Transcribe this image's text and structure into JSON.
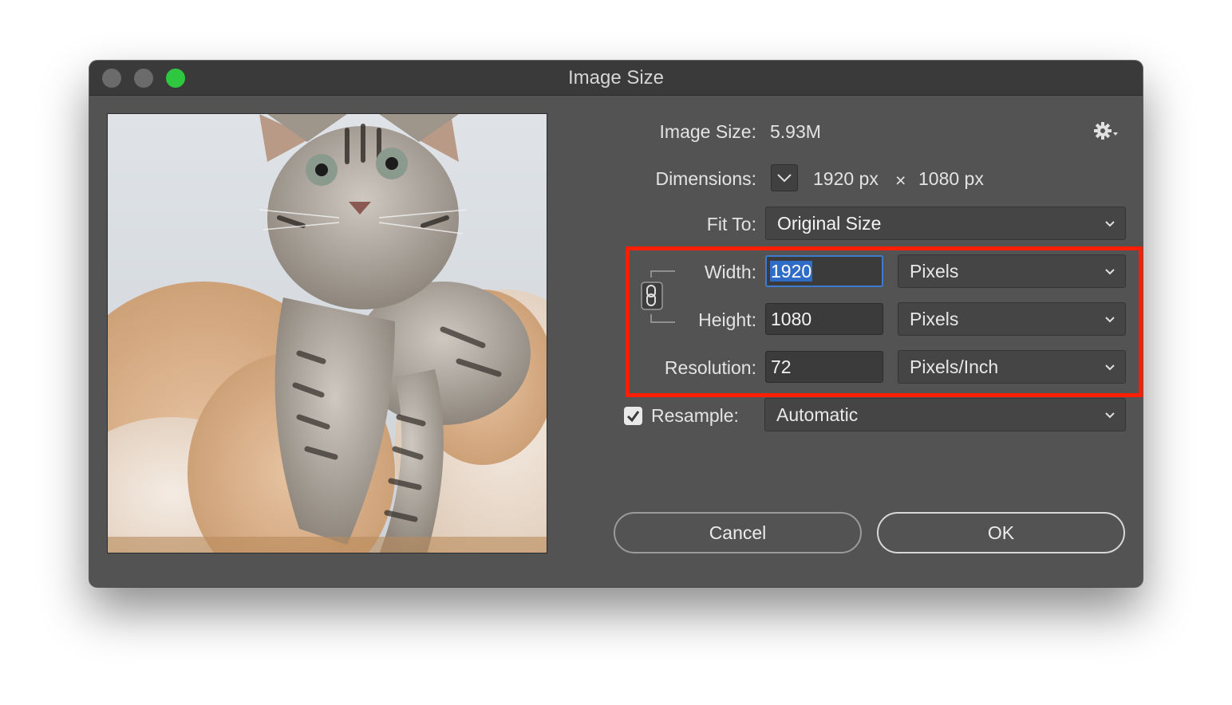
{
  "window": {
    "title": "Image Size"
  },
  "info": {
    "image_size_label": "Image Size:",
    "image_size_value": "5.93M",
    "dimensions_label": "Dimensions:",
    "dim_width": "1920 px",
    "dim_sep": "×",
    "dim_height": "1080 px"
  },
  "fit_to": {
    "label": "Fit To:",
    "value": "Original Size"
  },
  "width": {
    "label": "Width:",
    "value": "1920",
    "unit": "Pixels"
  },
  "height": {
    "label": "Height:",
    "value": "1080",
    "unit": "Pixels"
  },
  "resolution": {
    "label": "Resolution:",
    "value": "72",
    "unit": "Pixels/Inch"
  },
  "resample": {
    "label": "Resample:",
    "checked": true,
    "value": "Automatic"
  },
  "buttons": {
    "cancel": "Cancel",
    "ok": "OK"
  },
  "icons": {
    "settings": "gear-icon",
    "constrain": "chain-link-icon",
    "dimensions_toggle": "chevron-down-icon",
    "dropdown": "chevron-down-icon",
    "checkbox": "checkmark-icon"
  },
  "colors": {
    "window_bg": "#535353",
    "titlebar_bg": "#3a3a3a",
    "highlight_box": "#ff1f00",
    "focus_ring": "#3d7bd0",
    "zoom_button": "#2fc640"
  }
}
